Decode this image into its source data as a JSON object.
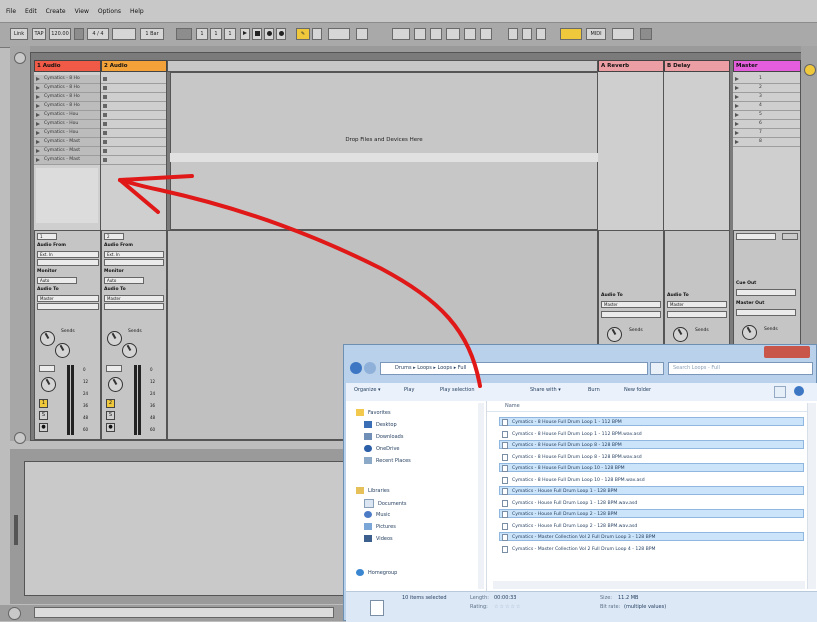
{
  "menu": [
    "File",
    "Edit",
    "Create",
    "View",
    "Options",
    "Help"
  ],
  "toolbar": {
    "link": "Link",
    "tap": "TAP",
    "tempo": "120.00",
    "meter": "4 / 4",
    "quant": "1 Bar",
    "pos1": "1",
    "pos2": "1",
    "pos3": "1",
    "cpu": "MIDI"
  },
  "tracks": [
    {
      "name": "1 Audio",
      "color": "#f05a46"
    },
    {
      "name": "2 Audio",
      "color": "#f3a23a"
    },
    {
      "name": "A Reverb",
      "color": "#ec9ea5"
    },
    {
      "name": "B Delay",
      "color": "#ec9ea5"
    },
    {
      "name": "Master",
      "color": "#e35ddc"
    }
  ],
  "track1_clips": [
    "Cymatics - 8 Ho",
    "Cymatics - 8 Ho",
    "Cymatics - 8 Ho",
    "Cymatics - 8 Ho",
    "Cymatics - Hou",
    "Cymatics - Hou",
    "Cymatics - Hou",
    "Cymatics - Mast",
    "Cymatics - Mast",
    "Cymatics - Mast"
  ],
  "master_scenes": [
    "1",
    "2",
    "3",
    "4",
    "5",
    "6",
    "7",
    "8"
  ],
  "drop_text": "Drop Files and Devices Here",
  "io": {
    "audio_from": "Audio From",
    "ext_in": "Ext. In",
    "monitor": "Monitor",
    "in": "In",
    "auto": "Auto",
    "off": "Off",
    "audio_to": "Audio To",
    "master": "Master",
    "cue_out": "Cue Out",
    "master_out": "Master Out",
    "sends": "Sends",
    "track1_num": "1",
    "track2_num": "2",
    "solo": "S",
    "meter_vals": [
      "0",
      "12",
      "24",
      "36",
      "48",
      "60"
    ]
  },
  "explorer": {
    "path": "Drums ▸ Loops ▸ Loops ▸ Full",
    "search_placeholder": "Search Loops - Full",
    "cmd": [
      "Organize ▾",
      "Play",
      "Play selection",
      "Share with ▾",
      "Burn",
      "New folder"
    ],
    "nav_favorites": "Favorites",
    "nav": [
      "Desktop",
      "Downloads",
      "OneDrive",
      "Recent Places"
    ],
    "nav_libraries": "Libraries",
    "libs": [
      "Documents",
      "Music",
      "Pictures",
      "Videos"
    ],
    "homegroup": "Homegroup",
    "col_name": "Name",
    "files": [
      "Cymatics - 8 House Full Drum Loop 1 - 112 BPM",
      "Cymatics - 8 House Full Drum Loop 1 - 112 BPM.wav.asd",
      "Cymatics - 8 House Full Drum Loop 8 - 128 BPM",
      "Cymatics - 8 House Full Drum Loop 8 - 128 BPM.wav.asd",
      "Cymatics - 8 House Full Drum Loop 10 - 128 BPM",
      "Cymatics - 8 House Full Drum Loop 10 - 128 BPM.wav.asd",
      "Cymatics - House Full Drum Loop 1 - 128 BPM",
      "Cymatics - House Full Drum Loop 1 - 128 BPM.wav.asd",
      "Cymatics - House Full Drum Loop 2 - 128 BPM",
      "Cymatics - House Full Drum Loop 2 - 128 BPM.wav.asd",
      "Cymatics - Master Collection Vol 2 Full Drum Loop 3 - 128 BPM",
      "Cymatics - Master Collection Vol 2 Full Drum Loop 4 - 128 BPM"
    ],
    "selected_rows": [
      0,
      2,
      4,
      6,
      8,
      10
    ],
    "status_count": "10 items selected",
    "status_length_label": "Length:",
    "status_length": "00:00:33",
    "status_rating_label": "Rating:",
    "status_size_label": "Size:",
    "status_size": "11.2 MB",
    "status_title_label": "Bit rate:",
    "status_title": "(multiple values)"
  },
  "colors": {
    "arrow": "#e01818",
    "accent_yellow": "#f0c83c"
  }
}
